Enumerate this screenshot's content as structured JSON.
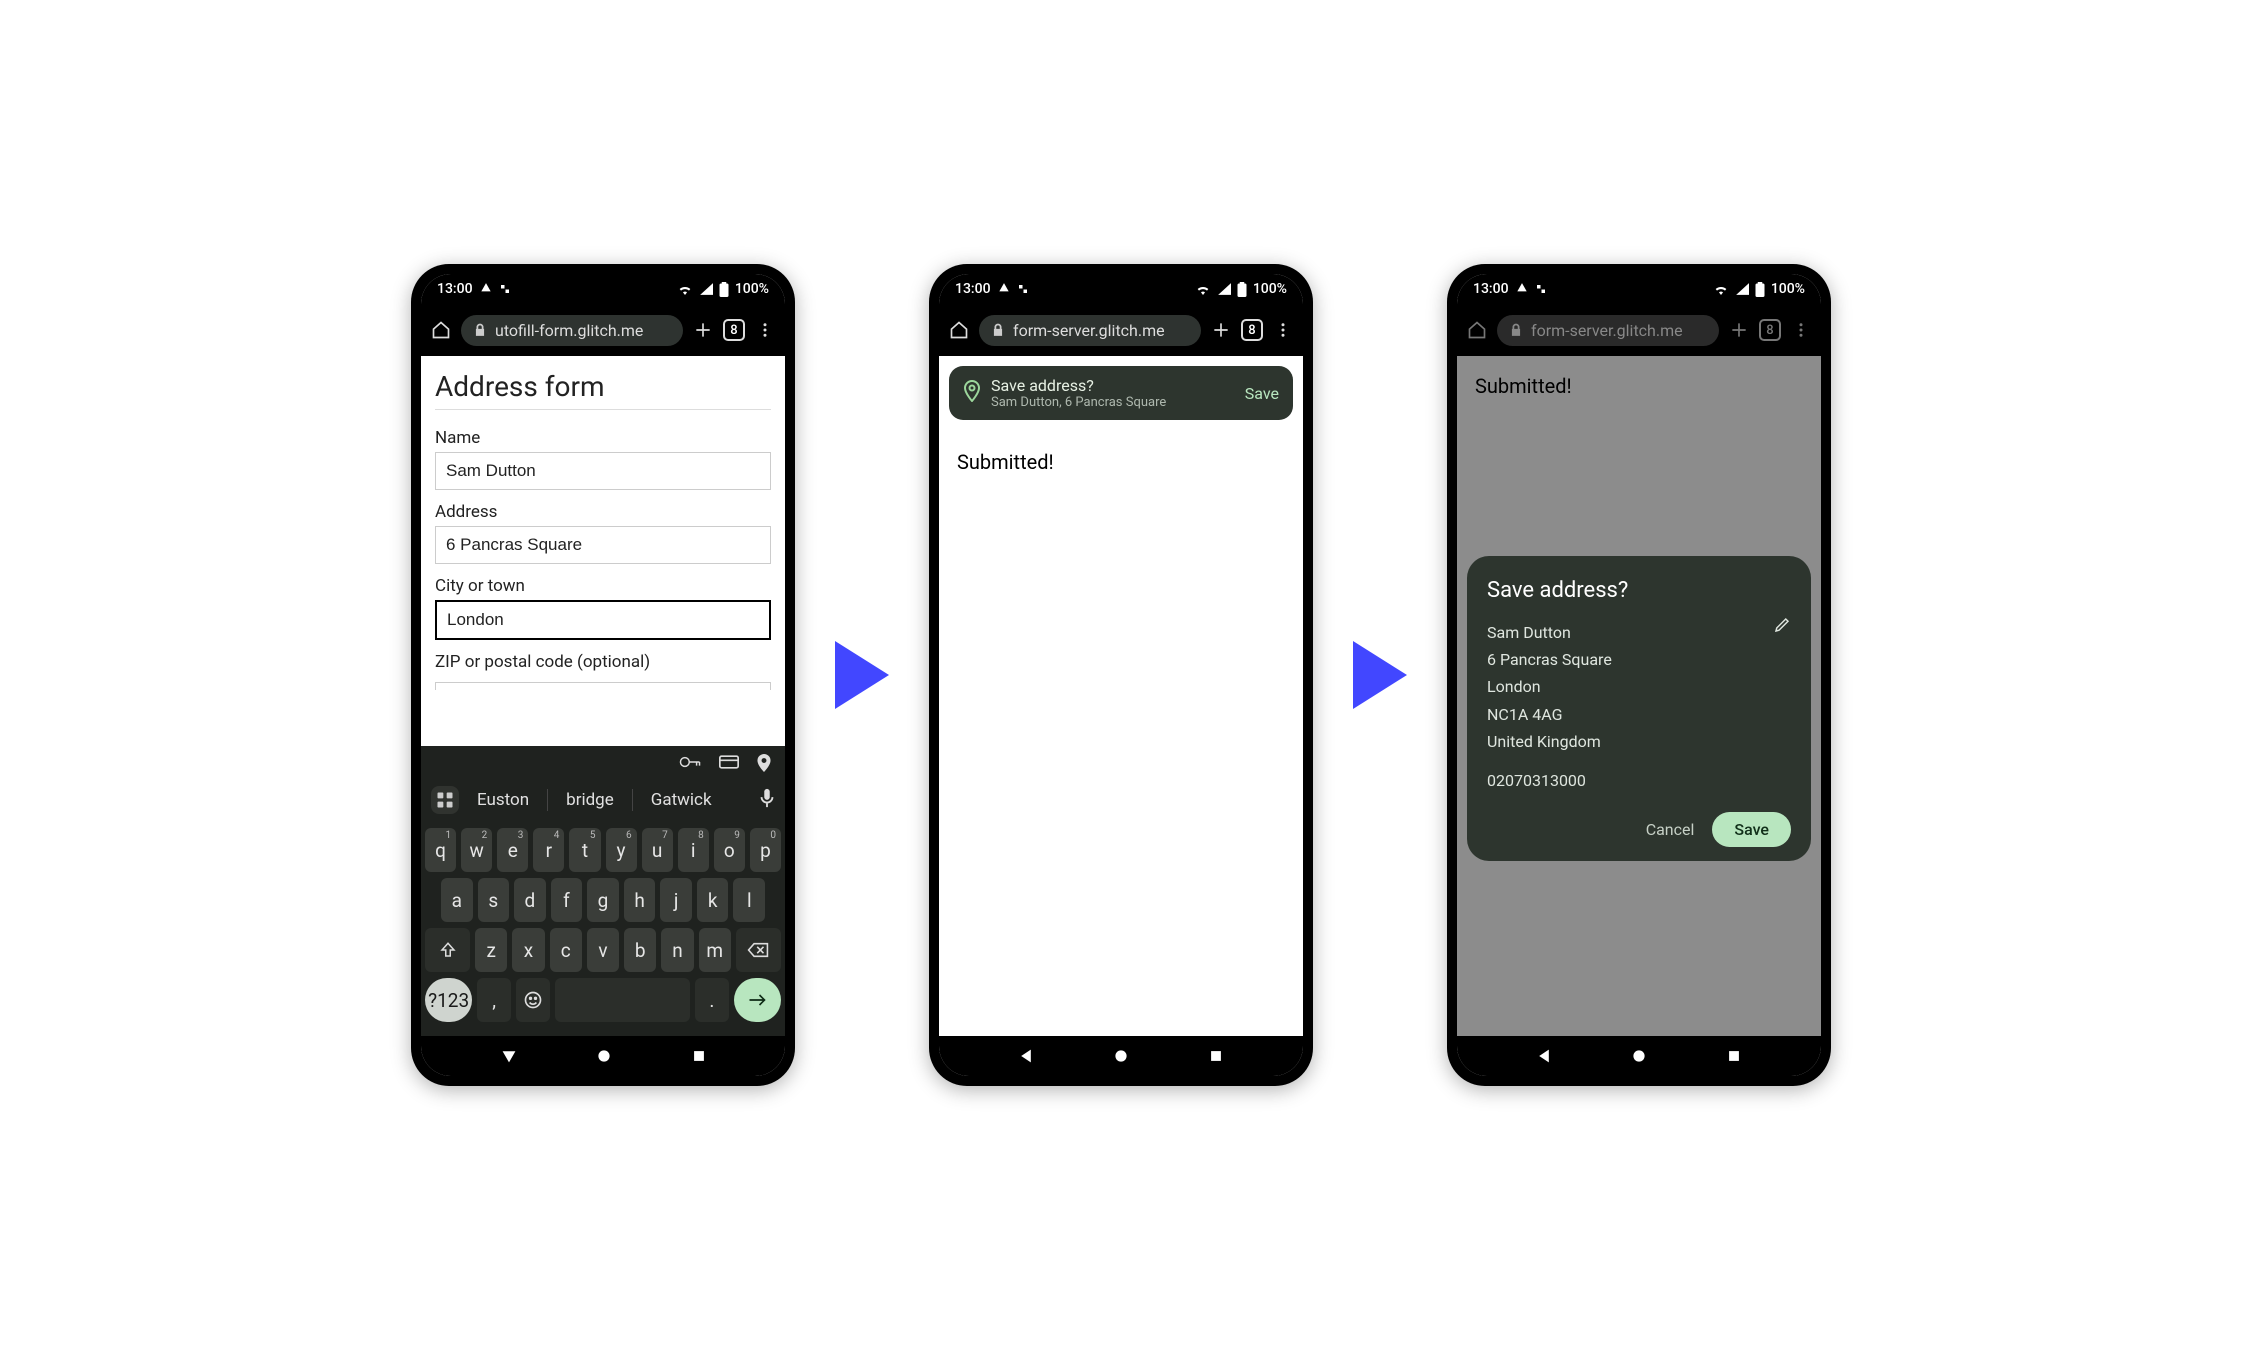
{
  "status": {
    "time": "13:00",
    "battery": "100%"
  },
  "toolbar": {
    "url_a": "utofill-form.glitch.me",
    "url_b": "form-server.glitch.me",
    "url_c": "form-server.glitch.me",
    "tab_count": "8"
  },
  "form": {
    "title": "Address form",
    "name_label": "Name",
    "name_value": "Sam Dutton",
    "address_label": "Address",
    "address_value": "6 Pancras Square",
    "city_label": "City or town",
    "city_value": "London",
    "zip_label": "ZIP or postal code (optional)"
  },
  "keyboard": {
    "suggestions": [
      "Euston",
      "bridge",
      "Gatwick"
    ],
    "row1": [
      [
        "q",
        "1"
      ],
      [
        "w",
        "2"
      ],
      [
        "e",
        "3"
      ],
      [
        "r",
        "4"
      ],
      [
        "t",
        "5"
      ],
      [
        "y",
        "6"
      ],
      [
        "u",
        "7"
      ],
      [
        "i",
        "8"
      ],
      [
        "o",
        "9"
      ],
      [
        "p",
        "0"
      ]
    ],
    "row2": [
      "a",
      "s",
      "d",
      "f",
      "g",
      "h",
      "j",
      "k",
      "l"
    ],
    "row3": [
      "z",
      "x",
      "c",
      "v",
      "b",
      "n",
      "m"
    ],
    "num_label": "?123",
    "comma": ",",
    "period": "."
  },
  "page2": {
    "submitted": "Submitted!",
    "chip_title": "Save address?",
    "chip_sub": "Sam Dutton, 6 Pancras Square",
    "chip_save": "Save"
  },
  "page3": {
    "submitted": "Submitted!",
    "dialog_title": "Save address?",
    "lines": [
      "Sam Dutton",
      "6 Pancras Square",
      "London",
      "NC1A 4AG",
      "United Kingdom"
    ],
    "phone": "02070313000",
    "cancel": "Cancel",
    "save": "Save"
  }
}
